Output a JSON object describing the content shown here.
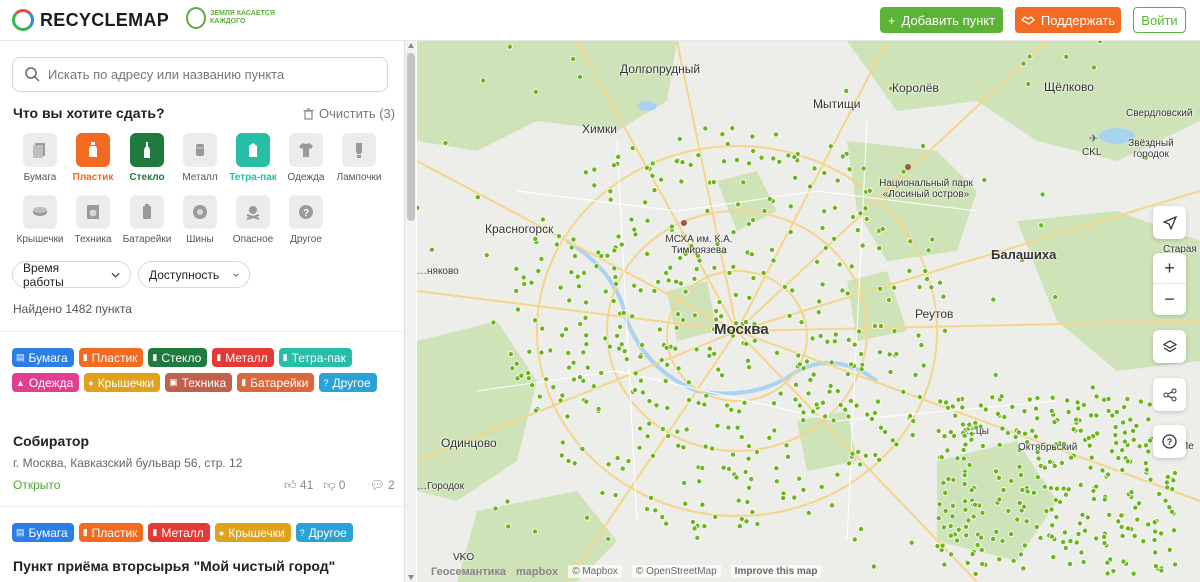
{
  "header": {
    "logo": "RECYCLEMAP",
    "slogan": "Земля касается каждого",
    "add_label": "Добавить пункт",
    "support_label": "Поддержать",
    "login_label": "Войти"
  },
  "search": {
    "placeholder": "Искать по адресу или названию пункта"
  },
  "filters": {
    "title": "Что вы хотите сдать?",
    "clear_label": "Очистить (3)",
    "categories": [
      {
        "label": "Бумага",
        "icon": "paper-icon",
        "selected": false
      },
      {
        "label": "Пластик",
        "icon": "plastic-bottle-icon",
        "selected": true,
        "color": "#f26b21"
      },
      {
        "label": "Стекло",
        "icon": "glass-bottle-icon",
        "selected": true,
        "color": "#1f7a3d"
      },
      {
        "label": "Металл",
        "icon": "metal-can-icon",
        "selected": false
      },
      {
        "label": "Тетра-пак",
        "icon": "tetra-pak-icon",
        "selected": true,
        "color": "#27bea8"
      },
      {
        "label": "Одежда",
        "icon": "clothes-icon",
        "selected": false
      },
      {
        "label": "Лампочки",
        "icon": "light-bulb-icon",
        "selected": false
      },
      {
        "label": "Крышечки",
        "icon": "bottle-cap-icon",
        "selected": false
      },
      {
        "label": "Техника",
        "icon": "appliance-icon",
        "selected": false
      },
      {
        "label": "Батарейки",
        "icon": "battery-icon",
        "selected": false
      },
      {
        "label": "Шины",
        "icon": "tire-icon",
        "selected": false
      },
      {
        "label": "Опасное",
        "icon": "hazard-icon",
        "selected": false
      },
      {
        "label": "Другое",
        "icon": "question-icon",
        "selected": false
      }
    ],
    "work_hours": "Время работы",
    "accessibility": "Доступность",
    "found": "Найдено 1482 пункта"
  },
  "results": [
    {
      "tags": [
        {
          "label": "Бумага",
          "color": "#2b7ee6"
        },
        {
          "label": "Пластик",
          "color": "#f26b21"
        },
        {
          "label": "Стекло",
          "color": "#1f7a3d"
        },
        {
          "label": "Металл",
          "color": "#e53935"
        },
        {
          "label": "Тетра-пак",
          "color": "#27bea8"
        },
        {
          "label": "Одежда",
          "color": "#e23e8f"
        },
        {
          "label": "Крышечки",
          "color": "#e0a21b"
        },
        {
          "label": "Техника",
          "color": "#c0604f"
        },
        {
          "label": "Батарейки",
          "color": "#d9683c"
        },
        {
          "label": "Другое",
          "color": "#2aa2d6"
        }
      ],
      "name": "Собиратор",
      "address": "г. Москва, Кавказский бульвар 56, стр. 12",
      "status": "Открыто",
      "likes": "41",
      "dislikes": "0",
      "comments": "2"
    },
    {
      "tags": [
        {
          "label": "Бумага",
          "color": "#2b7ee6"
        },
        {
          "label": "Пластик",
          "color": "#f26b21"
        },
        {
          "label": "Металл",
          "color": "#e53935"
        },
        {
          "label": "Крышечки",
          "color": "#e0a21b"
        },
        {
          "label": "Другое",
          "color": "#2aa2d6"
        }
      ],
      "name": "Пункт приёма вторсырья \"Мой чистый город\""
    }
  ],
  "map": {
    "labels": {
      "dolgoprudny": "Долгопрудный",
      "korolev": "Королёв",
      "shchelkovo": "Щёлково",
      "sverdlovsky": "Свердловский",
      "khimki": "Химки",
      "mytishchi": "Мытищи",
      "cklairport": "CKL",
      "zvezdny": "Звёздный городок",
      "mskha": "МСХА им. К.А. Тимирязева",
      "losiny": "Национальный парк «Лосиный остров»",
      "krasnogorsk": "Красногорск",
      "balashikha": "Балашиха",
      "staraya": "Старая Ку",
      "reutov": "Реутов",
      "moskva": "Москва",
      "nyakovo": "…няково",
      "odintsovo": "Одинцово",
      "gorodok": "…Городок",
      "vko": "VKO",
      "lyubertsy": "…цы",
      "oktyabrsky": "Октябрьский",
      "pe": "Пе"
    },
    "attribution": {
      "geo": "Геосемантика",
      "mapbox": "mapbox",
      "mapbox_copy": "© Mapbox",
      "osm": "© OpenStreetMap",
      "improve": "Improve this map"
    },
    "marker_color": "#6bb51a"
  }
}
